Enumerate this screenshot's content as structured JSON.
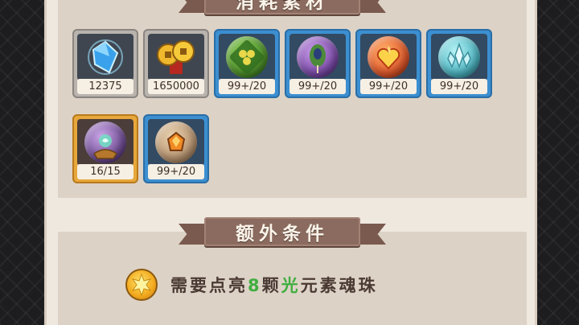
{
  "sections": {
    "materials_title": "消耗素材",
    "extra_title": "额外条件"
  },
  "materials": [
    {
      "icon": "blue-crystal-icon",
      "count": "12375",
      "frame": "gray"
    },
    {
      "icon": "gold-coins-icon",
      "count": "1650000",
      "frame": "gray"
    },
    {
      "icon": "green-clover-orb-icon",
      "count": "99+/20",
      "frame": "blue"
    },
    {
      "icon": "purple-feather-orb-icon",
      "count": "99+/20",
      "frame": "blue"
    },
    {
      "icon": "fire-heart-orb-icon",
      "count": "99+/20",
      "frame": "blue"
    },
    {
      "icon": "ice-crystal-orb-icon",
      "count": "99+/20",
      "frame": "blue"
    },
    {
      "icon": "spirit-altar-icon",
      "count": "16/15",
      "frame": "gold"
    },
    {
      "icon": "amber-stone-orb-icon",
      "count": "99+/20",
      "frame": "blue"
    }
  ],
  "condition": {
    "icon": "light-sun-orb-icon",
    "prefix": "需要点亮",
    "number": "8",
    "mid": "颗",
    "element": "光",
    "suffix": "元素魂珠",
    "accent_color": "#3fae3f"
  }
}
